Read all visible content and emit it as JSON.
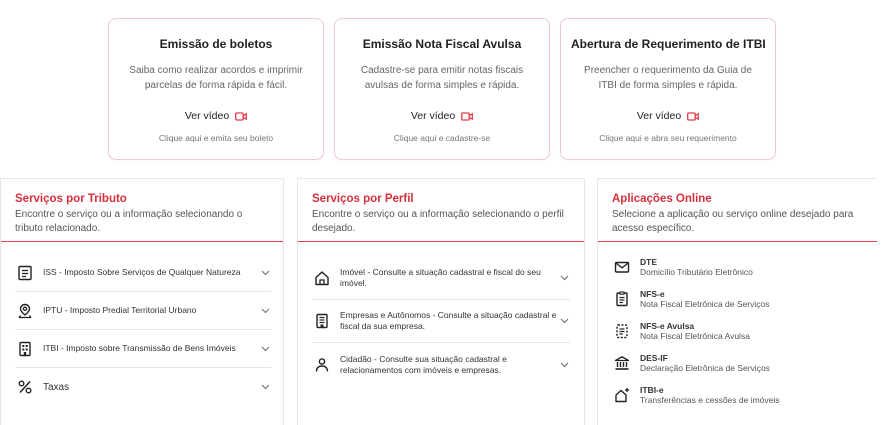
{
  "cards": [
    {
      "title": "Emissão de boletos",
      "desc": "Saiba como realizar acordos e imprimir parcelas de forma rápida e fácil.",
      "video": "Ver vídeo",
      "hint": "Clique aqui e emita seu boleto"
    },
    {
      "title": "Emissão Nota Fiscal Avulsa",
      "desc": "Cadastre-se para emitir notas fiscais avulsas de forma simples e rápida.",
      "video": "Ver vídeo",
      "hint": "Clique aqui e cadastre-se"
    },
    {
      "title": "Abertura de Requerimento de ITBI",
      "desc": "Preencher o requerimento da Guia de ITBI de forma simples e rápida.",
      "video": "Ver vídeo",
      "hint": "Clique aqui e abra seu requerimento"
    }
  ],
  "tributo": {
    "title": "Serviços por Tributo",
    "subtitle": "Encontre o serviço ou a informação selecionando o tributo relacionado.",
    "items": [
      {
        "label": "ISS - Imposto Sobre Serviços de Qualquer Natureza",
        "icon": "document-icon"
      },
      {
        "label": "IPTU - Imposto Predial Territorial Urbano",
        "icon": "location-icon"
      },
      {
        "label": "ITBI - Imposto sobre Transmissão de Bens Imóveis",
        "icon": "building-doc-icon"
      },
      {
        "label": "Taxas",
        "icon": "percent-icon"
      }
    ]
  },
  "perfil": {
    "title": "Serviços por Perfil",
    "subtitle": "Encontre o serviço ou a informação selecionando o perfil desejado.",
    "items": [
      {
        "label": "Imóvel - Consulte a situação cadastral e fiscal do seu imóvel.",
        "icon": "house-icon"
      },
      {
        "label": "Empresas e Autônomos - Consulte a situação cadastral e fiscal da sua empresa.",
        "icon": "building-icon"
      },
      {
        "label": "Cidadão - Consulte sua situação cadastral e relacionamentos com imóveis e empresas.",
        "icon": "person-icon"
      }
    ]
  },
  "online": {
    "title": "Aplicações Online",
    "subtitle": "Selecione a aplicação ou serviço online desejado para acesso específico.",
    "items": [
      {
        "name": "DTE",
        "desc": "Domicílio Tributário Eletrônico",
        "icon": "envelope-icon"
      },
      {
        "name": "NFS-e",
        "desc": "Nota Fiscal Eletrônica de Serviços",
        "icon": "invoice-icon"
      },
      {
        "name": "NFS-e Avulsa",
        "desc": "Nota Fiscal Eletrônica Avulsa",
        "icon": "invoice-dashed-icon"
      },
      {
        "name": "DES-IF",
        "desc": "Declaração Eletrônica de Serviços",
        "icon": "bank-icon"
      },
      {
        "name": "ITBI-e",
        "desc": "Transferências e cessões de imóveis",
        "icon": "house-plus-icon"
      }
    ]
  },
  "colors": {
    "accent": "#d5303d",
    "card_border": "#f1c8cb"
  }
}
